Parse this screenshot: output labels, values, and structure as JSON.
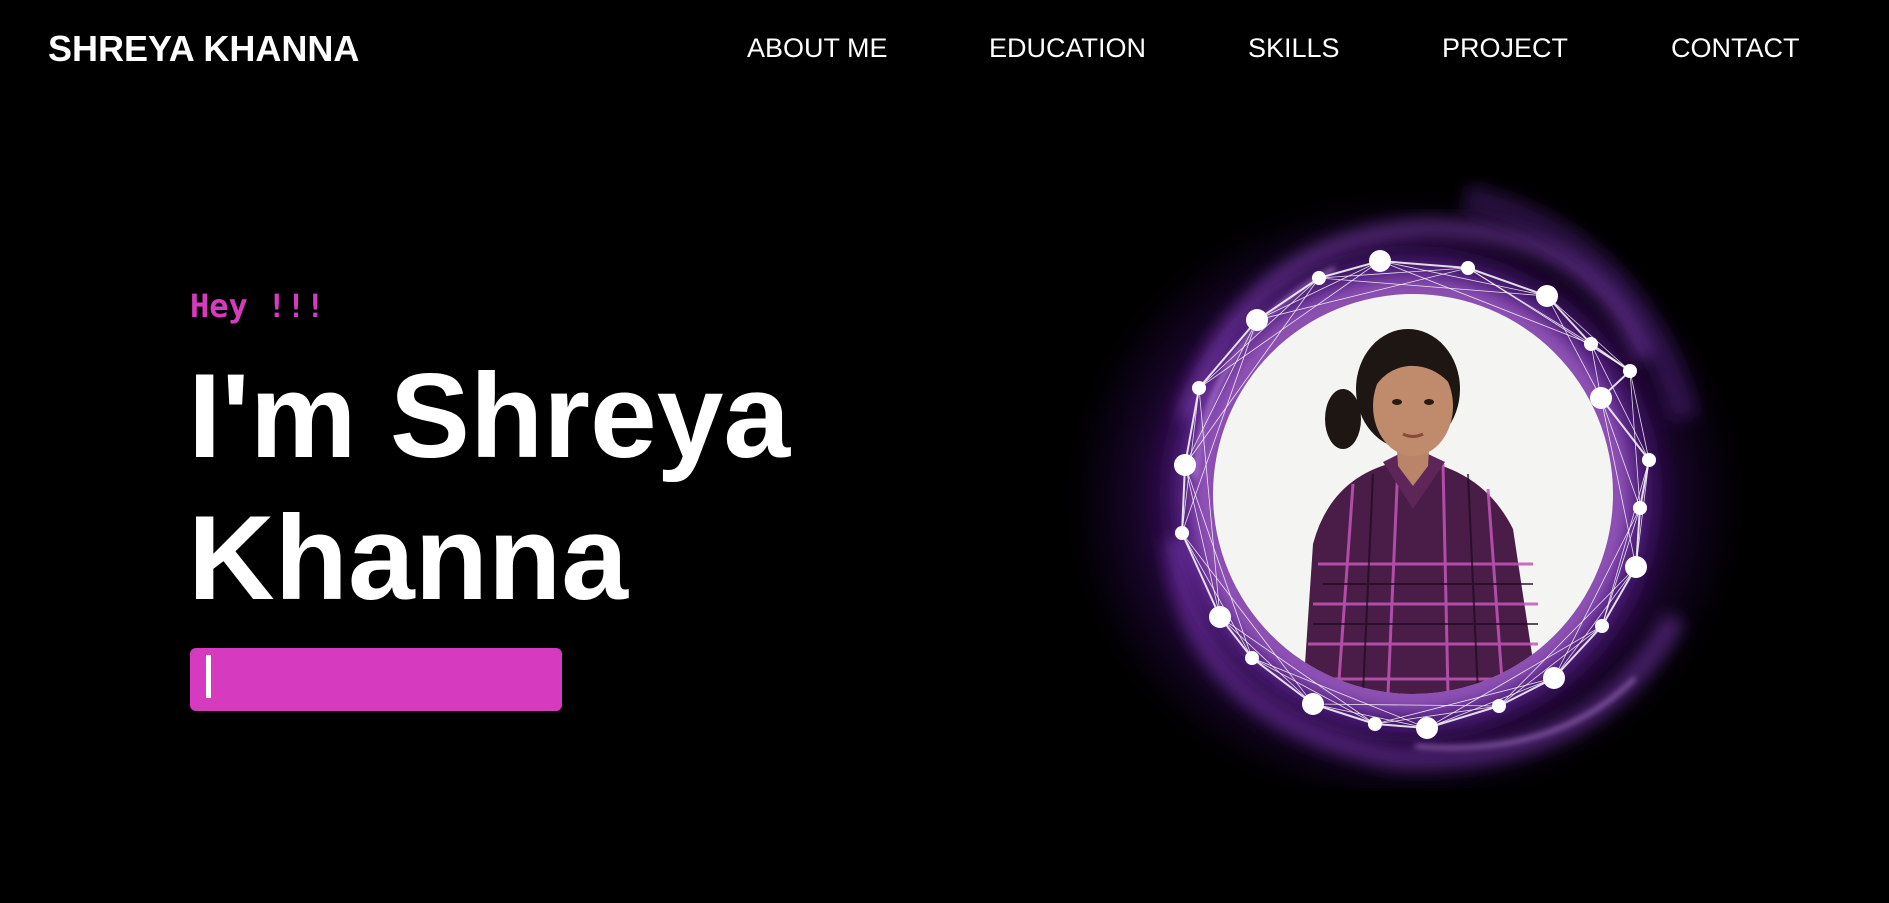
{
  "brand": {
    "name": "SHREYA KHANNA"
  },
  "nav": {
    "items": [
      {
        "label": "ABOUT ME"
      },
      {
        "label": "EDUCATION"
      },
      {
        "label": "SKILLS"
      },
      {
        "label": "PROJECT"
      },
      {
        "label": "CONTACT"
      }
    ]
  },
  "hero": {
    "greeting": "Hey !!!",
    "name_line1": "I'm Shreya",
    "name_line2": "Khanna",
    "typing_text": ""
  },
  "colors": {
    "background": "#000000",
    "accent": "#d63bbf",
    "text": "#ffffff",
    "glow": "#8a2be2"
  },
  "icons": {
    "profile_photo": "profile-photo",
    "network_ring": "network-ring-decoration"
  }
}
